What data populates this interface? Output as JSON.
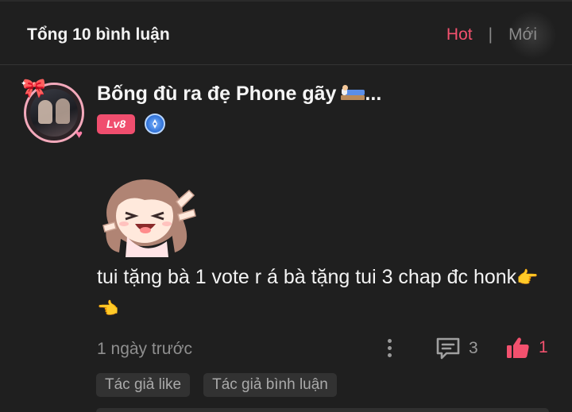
{
  "header": {
    "title": "Tổng 10 bình luận",
    "sort_hot": "Hot",
    "sort_separator": "|",
    "sort_new": "Mới",
    "accent_color": "#f2516e"
  },
  "comment": {
    "username": "Bống đù ra đẹ Phone gãy",
    "username_suffix": "...",
    "username_emoji_icon": "bed-icon",
    "level": "Lv8",
    "level_color": "#f04e6e",
    "badge_icon": "pen-badge-icon",
    "sticker_icon": "anime-girl-sticker",
    "text_line": "tui tặng bà 1 vote r á bà tặng tui 3 chap đc honk",
    "text_emoji": "👉👈",
    "time": "1 ngày trước",
    "reply_count": "3",
    "like_count": "1",
    "tags": [
      "Tác giả like",
      "Tác giả bình luận"
    ]
  }
}
